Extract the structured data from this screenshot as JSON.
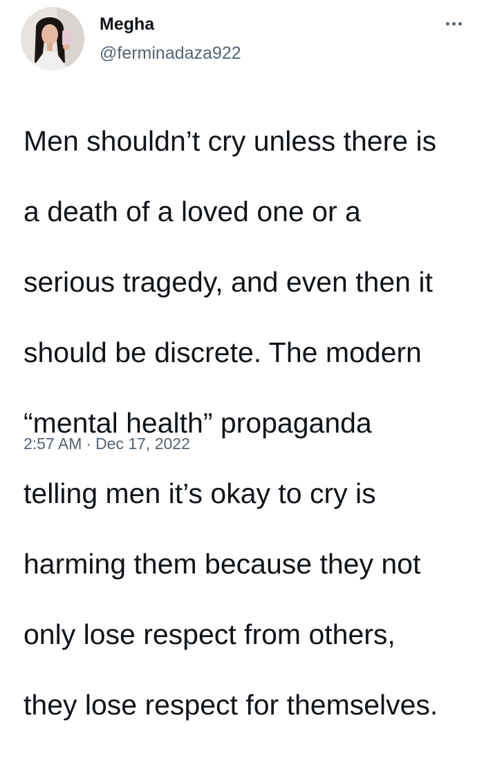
{
  "author": {
    "display_name": "Megha",
    "handle": "@ferminadaza922"
  },
  "more_icon": "more-horizontal-icon",
  "tweet": {
    "text_lines": [
      "Men shouldn’t cry unless there is",
      "a death of a loved one or a",
      "serious tragedy, and even then it",
      "should be discrete. The modern",
      "“mental health” propaganda",
      "telling men it’s okay to cry is",
      "harming them because they not",
      "only lose respect from others,",
      "they lose respect for themselves."
    ],
    "time": "2:57 AM",
    "separator": "·",
    "date": "Dec 17, 2022"
  },
  "colors": {
    "text_primary": "#0f1419",
    "text_secondary": "#536471",
    "background": "#ffffff"
  }
}
